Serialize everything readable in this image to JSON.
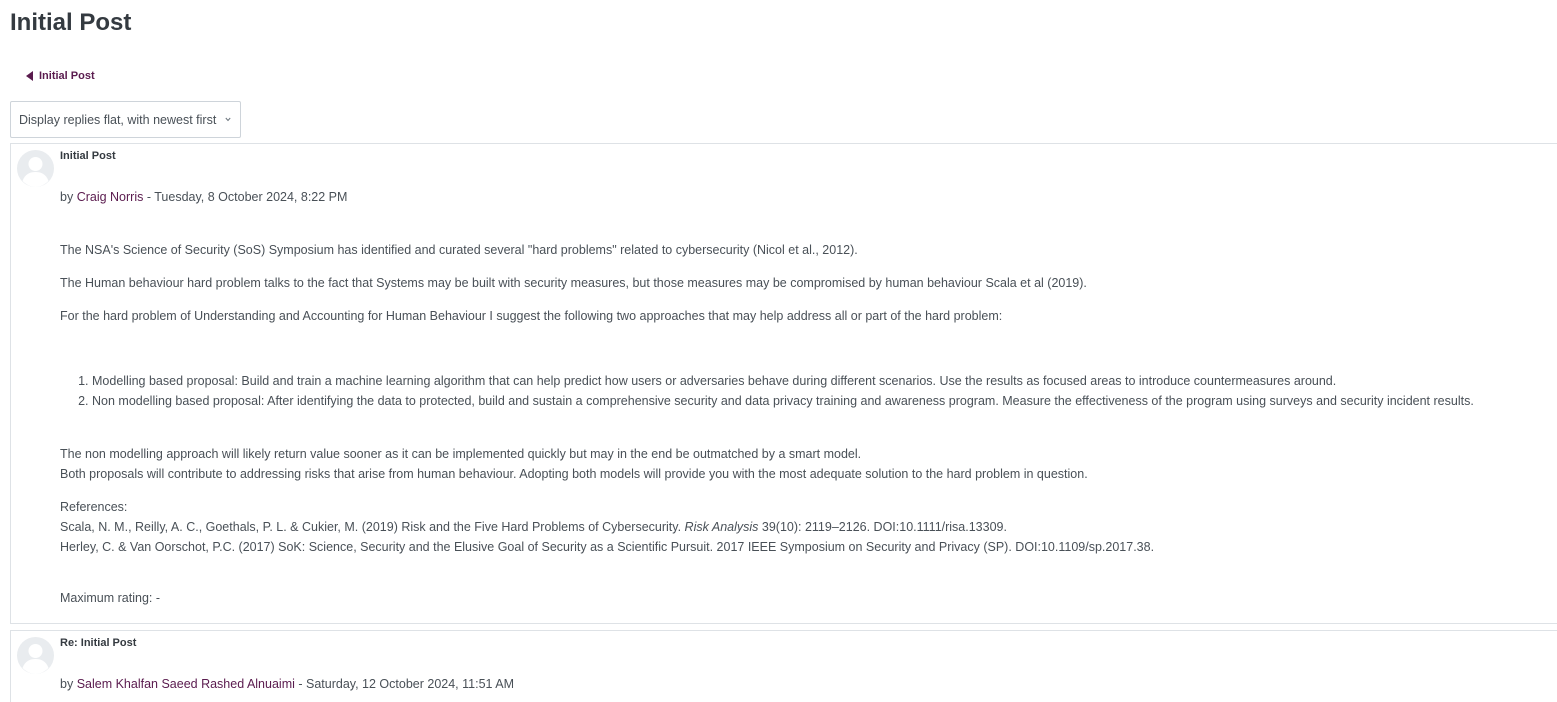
{
  "page": {
    "title": "Initial Post",
    "back_link": "Initial Post",
    "display_mode": "Display replies flat, with newest first"
  },
  "colors": {
    "link": "#5a1b4e",
    "text": "#495057",
    "border": "#dee2e6"
  },
  "posts": [
    {
      "subject": "Initial Post",
      "by_prefix": "by",
      "author": "Craig Norris",
      "date": " - Tuesday, 8 October 2024, 8:22 PM",
      "paragraphs": [
        "The NSA's Science of Security (SoS) Symposium has identified and curated several \"hard problems\" related to cybersecurity (Nicol et al., 2012).",
        "The Human behaviour hard problem talks to the fact that Systems may be built with security measures, but those measures may be compromised by human behaviour Scala et al (2019).",
        "For the hard problem of Understanding and Accounting for Human Behaviour I suggest the following two approaches that may help address all or part of the hard problem:"
      ],
      "list": [
        "Modelling based proposal: Build and train a machine learning algorithm that can help predict how users or adversaries behave during different scenarios. Use the results as focused areas to introduce countermeasures around.",
        "Non modelling based proposal: After identifying the data to protected, build and sustain a comprehensive security and data privacy training and awareness program. Measure the effectiveness of the program using surveys and security incident results."
      ],
      "conclusion": [
        "The non modelling approach will likely return value sooner as it can be implemented quickly  but may in the end be outmatched by a smart model.",
        "Both proposals will contribute to addressing risks that arise from human behaviour. Adopting both models will provide you with the most adequate solution to the hard problem in question."
      ],
      "references_label": "References:",
      "ref1_pre": "Scala, N. M., Reilly, A. C., Goethals, P. L. & Cukier, M. (2019) Risk and the Five Hard Problems of Cybersecurity. ",
      "ref1_journal": "Risk Analysis",
      "ref1_post": " 39(10): 2119–2126. DOI:10.1111/risa.13309.",
      "ref2": "Herley, C. & Van Oorschot, P.C. (2017) SoK: Science, Security and the Elusive Goal of Security as a Scientific Pursuit. 2017 IEEE Symposium on Security and Privacy (SP). DOI:10.1109/sp.2017.38.",
      "rating": "Maximum rating: -"
    },
    {
      "subject": "Re: Initial Post",
      "by_prefix": "by",
      "author": "Salem Khalfan Saeed Rashed Alnuaimi",
      "date": " - Saturday, 12 October 2024, 11:51 AM"
    }
  ]
}
